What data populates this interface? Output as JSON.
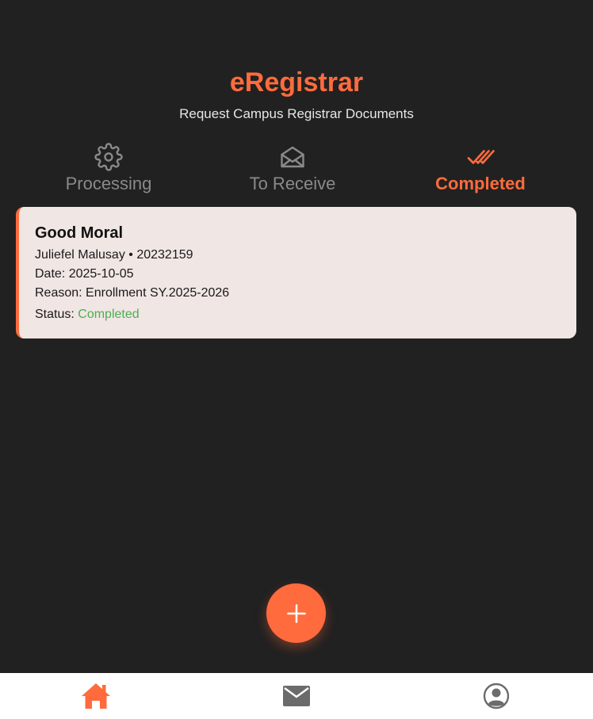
{
  "header": {
    "title": "eRegistrar",
    "subtitle": "Request Campus Registrar Documents"
  },
  "tabs": [
    {
      "label": "Processing",
      "icon": "gear-icon",
      "active": false
    },
    {
      "label": "To Receive",
      "icon": "envelope-open-icon",
      "active": false
    },
    {
      "label": "Completed",
      "icon": "double-check-icon",
      "active": true
    }
  ],
  "requests": [
    {
      "title": "Good Moral",
      "student_line": "Juliefel Malusay • 20232159",
      "date_line": "Date: 2025-10-05",
      "reason_line": "Reason: Enrollment SY.2025-2026",
      "status_label": "Status:",
      "status_value": "Completed"
    }
  ],
  "fab": {
    "icon": "plus-icon"
  },
  "bottom_nav": [
    {
      "icon": "home-icon",
      "active": true
    },
    {
      "icon": "mail-icon",
      "active": false
    },
    {
      "icon": "profile-icon",
      "active": false
    }
  ],
  "colors": {
    "accent": "#ff6b3d",
    "background": "#212121",
    "card": "#f0e6e4",
    "status_completed": "#4caf50",
    "inactive": "#8a8a8a"
  }
}
